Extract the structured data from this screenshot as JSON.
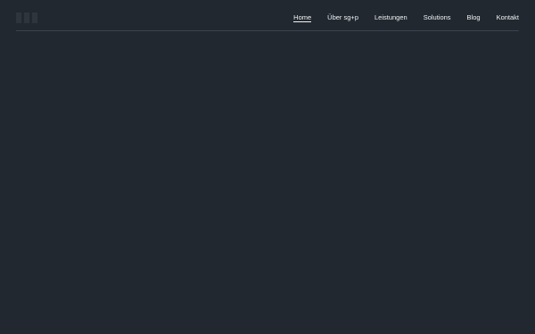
{
  "header": {
    "logo_icon": "logo-icon",
    "nav": [
      {
        "label": "Home",
        "active": true
      },
      {
        "label": "Über sg+p",
        "active": false
      },
      {
        "label": "Leistungen",
        "active": false
      },
      {
        "label": "Solutions",
        "active": false
      },
      {
        "label": "Blog",
        "active": false
      },
      {
        "label": "Kontakt",
        "active": false
      }
    ]
  },
  "colors": {
    "background": "#212830",
    "nav_text": "#f2f4f6",
    "divider": "#3b434c"
  }
}
